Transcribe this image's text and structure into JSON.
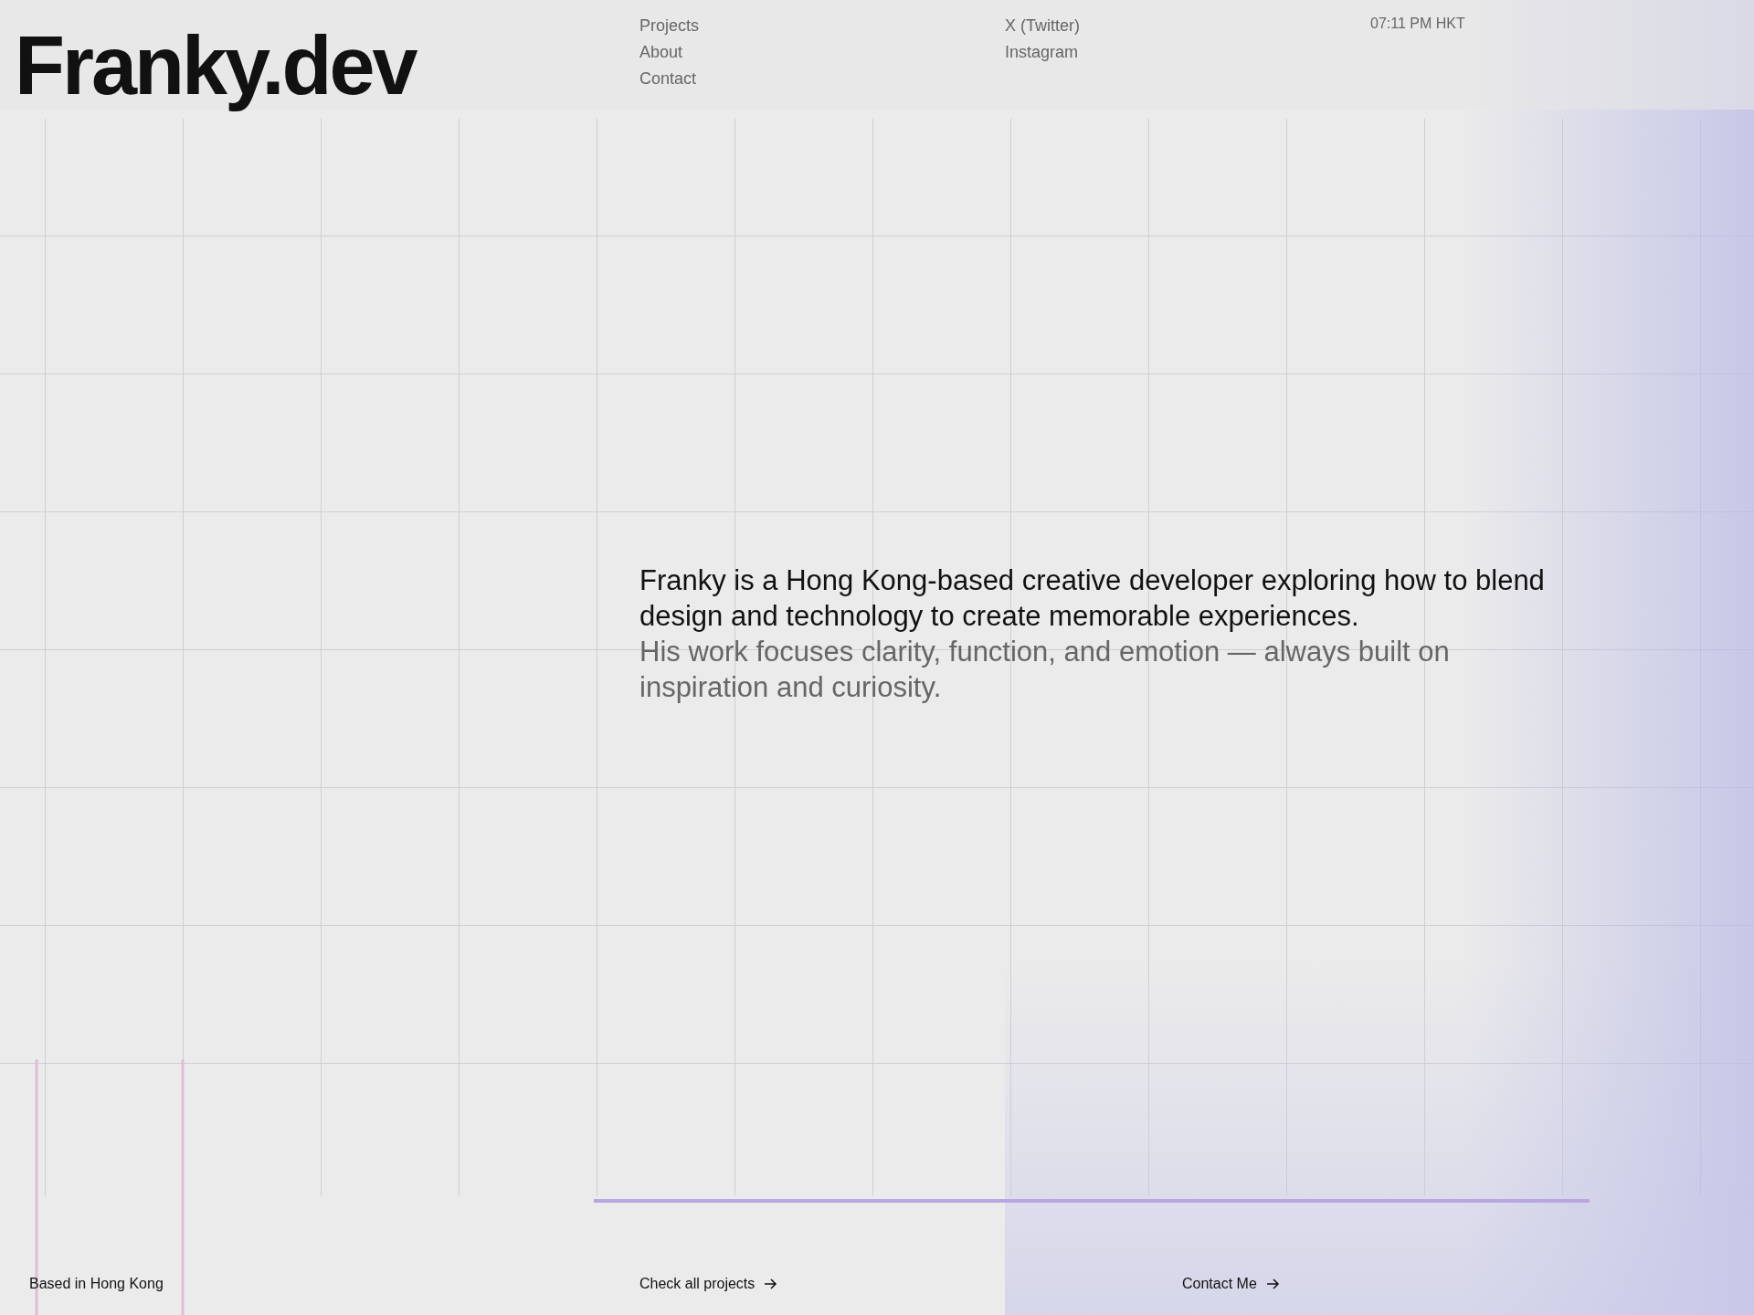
{
  "logo": "Franky.dev",
  "nav": [
    "Projects",
    "About",
    "Contact"
  ],
  "social": [
    "X (Twitter)",
    "Instagram"
  ],
  "clock": "07:11 PM HKT",
  "background": {
    "kind": "picture"
  },
  "intro": {
    "lead": "Franky is a Hong Kong-based creative developer exploring how to blend design and technology to create memorable experiences.",
    "secondary": "His work focuses clarity, function, and emotion — always built on inspiration and curiosity."
  },
  "footer": {
    "location": "Based in Hong Kong",
    "links": [
      {
        "label": "Check all projects"
      },
      {
        "label": "Contact Me"
      }
    ]
  }
}
